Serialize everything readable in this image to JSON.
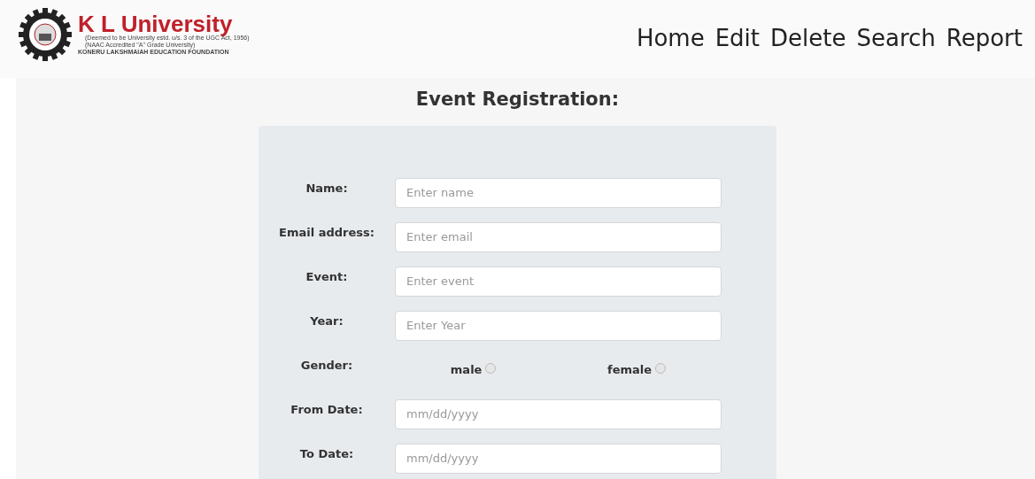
{
  "logo": {
    "name": "K L University",
    "lines": [
      "(Deemed to be University estd. u/s. 3 of the UGC Act, 1956)",
      "(NAAC Accredited \"A\" Grade University)",
      "KONERU LAKSHMAIAH EDUCATION FOUNDATION"
    ]
  },
  "nav": [
    "Home",
    "Edit",
    "Delete",
    "Search",
    "Report"
  ],
  "form": {
    "title": "Event Registration:",
    "fields": [
      {
        "kind": "text",
        "label": "Name:",
        "placeholder": "Enter name"
      },
      {
        "kind": "text",
        "label": "Email address:",
        "placeholder": "Enter email"
      },
      {
        "kind": "text",
        "label": "Event:",
        "placeholder": "Enter event"
      },
      {
        "kind": "text",
        "label": "Year:",
        "placeholder": "Enter Year"
      },
      {
        "kind": "radio",
        "label": "Gender:",
        "options": [
          {
            "label": "male",
            "selected": false
          },
          {
            "label": "female",
            "selected": false
          }
        ]
      },
      {
        "kind": "date",
        "label": "From Date:",
        "placeholder": "mm/dd/yyyy"
      },
      {
        "kind": "date",
        "label": "To Date:",
        "placeholder": "mm/dd/yyyy"
      }
    ]
  }
}
